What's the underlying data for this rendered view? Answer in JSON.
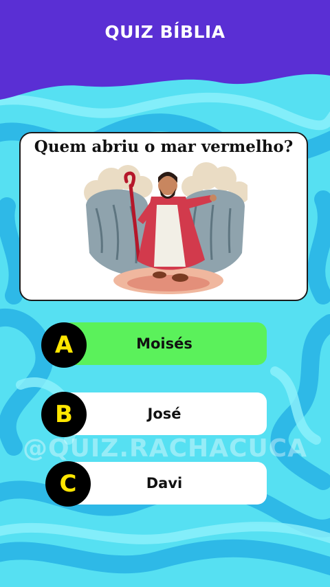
{
  "header": {
    "title": "QUIZ BÍBLIA"
  },
  "question": {
    "text": "Quem abriu o mar vermelho?"
  },
  "answers": [
    {
      "letter": "A",
      "text": "Moisés",
      "state": "correct"
    },
    {
      "letter": "B",
      "text": "José",
      "state": "neutral"
    },
    {
      "letter": "C",
      "text": "Davi",
      "state": "neutral"
    }
  ],
  "watermark": "@QUIZ.RACHACUCA",
  "colors": {
    "header_bg": "#5a2fd4",
    "background": "#56e0f2",
    "correct": "#5bf15b",
    "letter_bg": "#000000",
    "letter_fg": "#ffe600"
  },
  "icons": {
    "illustration": "moses-parting-red-sea-illustration"
  }
}
